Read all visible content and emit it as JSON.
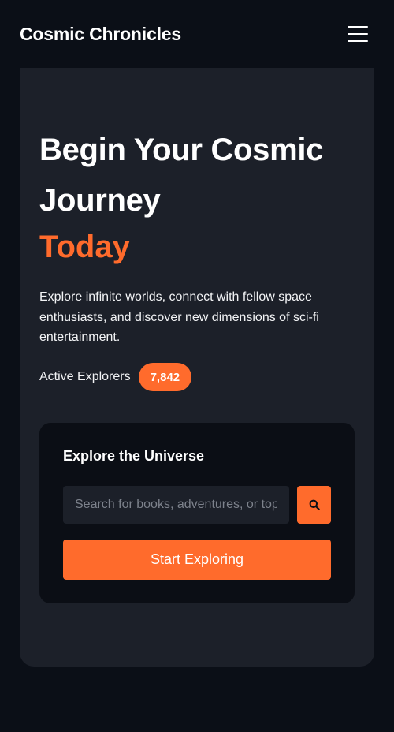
{
  "header": {
    "brand": "Cosmic Chronicles",
    "menu_icon": "hamburger-menu-icon"
  },
  "hero": {
    "title": "Begin Your Cosmic Journey",
    "accent": "Today",
    "description": "Explore infinite worlds, connect with fellow space enthusiasts, and discover new dimensions of sci-fi entertainment.",
    "stats_label": "Active Explorers",
    "stats_value": "7,842"
  },
  "explore": {
    "title": "Explore the Universe",
    "search_placeholder": "Search for books, adventures, or topics...",
    "search_value": "",
    "search_icon": "search-icon",
    "cta_label": "Start Exploring"
  },
  "colors": {
    "background": "#0b0f17",
    "card": "#1c2029",
    "panel": "#0b0e15",
    "accent": "#ff6b2c"
  }
}
